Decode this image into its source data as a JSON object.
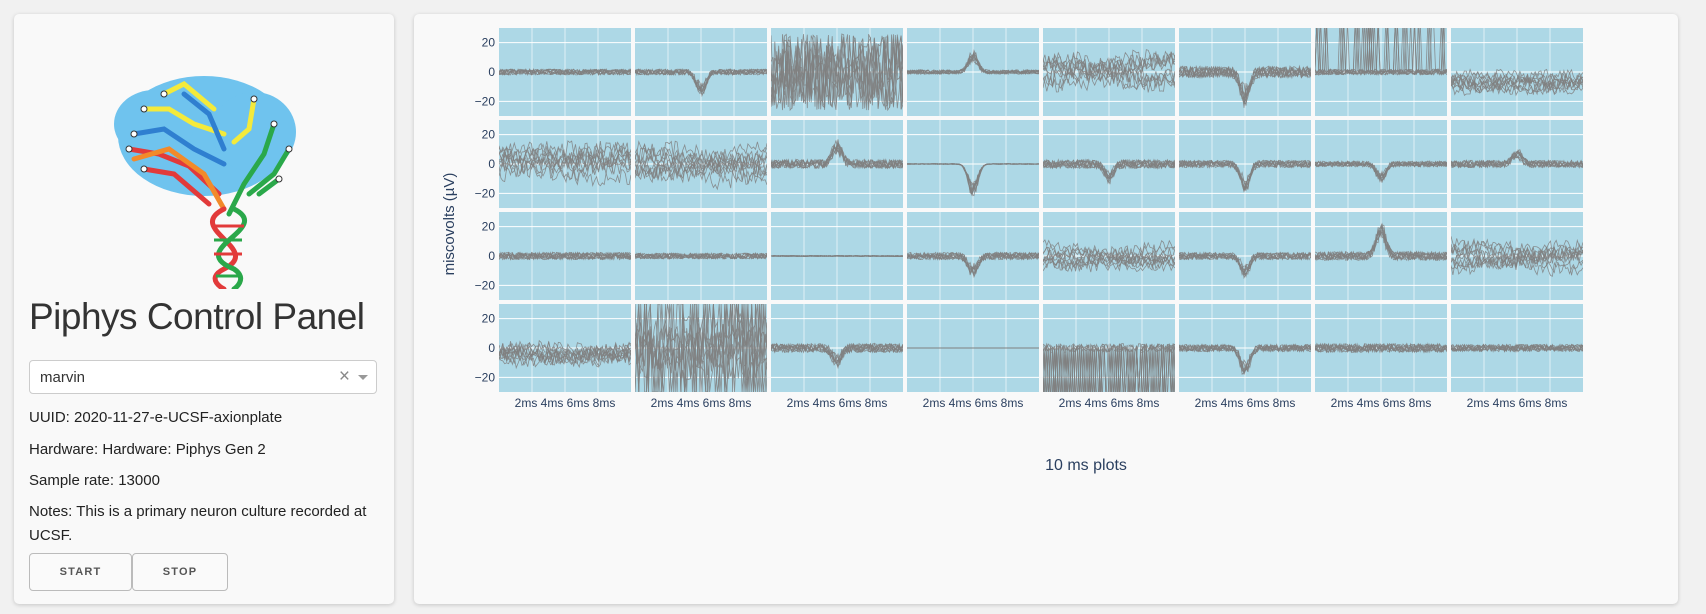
{
  "app": {
    "title": "Piphys Control Panel",
    "device_select": {
      "value": "marvin"
    },
    "info": {
      "uuid": "UUID: 2020-11-27-e-UCSF-axionplate",
      "hardware": "Hardware: Hardware: Piphys Gen 2",
      "sample_rate": "Sample rate: 13000",
      "notes": "Notes: This is a primary neuron culture recorded at UCSF."
    },
    "buttons": {
      "start": "START",
      "stop": "STOP"
    }
  },
  "colors": {
    "plot_bg": "#add8e6",
    "trace": "#808080",
    "axis_text": "#2a3f5f"
  },
  "chart_data": {
    "type": "line",
    "title": "",
    "layout": "small-multiples",
    "rows": 4,
    "cols": 8,
    "xlabel": "10 ms plots",
    "ylabel": "miscovolts (µV)",
    "ylim": [
      -30,
      30
    ],
    "yticks": [
      "20",
      "0",
      "−20"
    ],
    "xtick_labels": [
      "2ms",
      "4ms",
      "6ms",
      "8ms"
    ],
    "grid": true,
    "legend": "none",
    "panels": [
      [
        {
          "style": "noise",
          "amp": 4
        },
        {
          "style": "spike",
          "amp": 4,
          "spike": -14
        },
        {
          "style": "chaos",
          "amp": 26
        },
        {
          "style": "spike",
          "amp": 3,
          "spike": 12
        },
        {
          "style": "wavy",
          "amp": 12
        },
        {
          "style": "spike",
          "amp": 8,
          "spike": -18
        },
        {
          "style": "saturate_top",
          "amp": 4
        },
        {
          "style": "wavy_low",
          "amp": 8
        }
      ],
      [
        {
          "style": "wavy",
          "amp": 12
        },
        {
          "style": "wavy",
          "amp": 12
        },
        {
          "style": "spike",
          "amp": 6,
          "spike": 14
        },
        {
          "style": "flat_dip",
          "amp": 0.5,
          "spike": -20
        },
        {
          "style": "spike",
          "amp": 6,
          "spike": -10
        },
        {
          "style": "spike",
          "amp": 5,
          "spike": -16
        },
        {
          "style": "spike",
          "amp": 4,
          "spike": -10
        },
        {
          "style": "spike",
          "amp": 5,
          "spike": 8
        }
      ],
      [
        {
          "style": "noise",
          "amp": 5
        },
        {
          "style": "noise",
          "amp": 4
        },
        {
          "style": "flat",
          "amp": 0.7
        },
        {
          "style": "spike",
          "amp": 5,
          "spike": -12
        },
        {
          "style": "wavy",
          "amp": 8
        },
        {
          "style": "spike",
          "amp": 5,
          "spike": -12
        },
        {
          "style": "spike",
          "amp": 6,
          "spike": 20
        },
        {
          "style": "wavy",
          "amp": 10
        }
      ],
      [
        {
          "style": "wavy",
          "amp": 10
        },
        {
          "style": "chaos_band",
          "amp": 26
        },
        {
          "style": "spike",
          "amp": 6,
          "spike": -10
        },
        {
          "style": "flat",
          "amp": 0.2
        },
        {
          "style": "saturate_bottom",
          "amp": 6
        },
        {
          "style": "spike",
          "amp": 5,
          "spike": -16
        },
        {
          "style": "noise",
          "amp": 6
        },
        {
          "style": "noise",
          "amp": 5
        }
      ]
    ]
  }
}
